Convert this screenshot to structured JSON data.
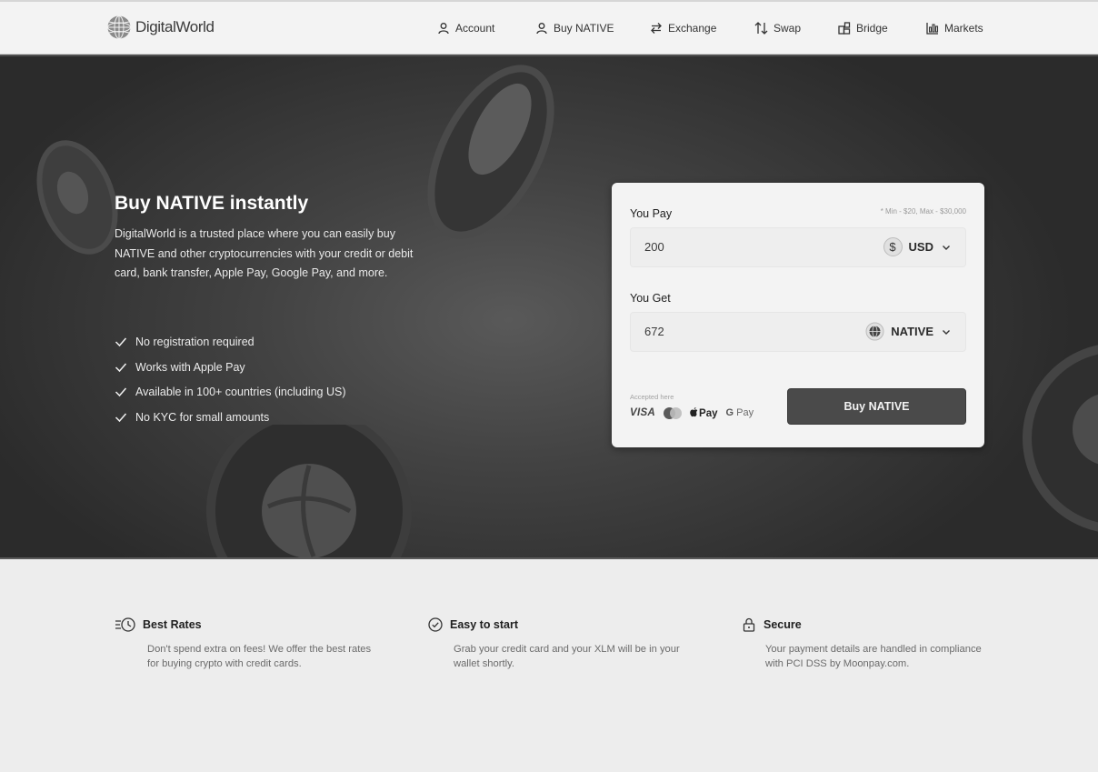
{
  "header": {
    "logo_text": "DigitalWorld",
    "nav": [
      {
        "label": "Account",
        "icon": "user-icon"
      },
      {
        "label": "Buy NATIVE",
        "icon": "user-icon"
      },
      {
        "label": "Exchange",
        "icon": "exchange-icon"
      },
      {
        "label": "Swap",
        "icon": "swap-icon"
      },
      {
        "label": "Bridge",
        "icon": "bridge-icon"
      },
      {
        "label": "Markets",
        "icon": "markets-icon"
      }
    ]
  },
  "hero": {
    "title": "Buy NATIVE instantly",
    "description": "DigitalWorld is a trusted place where you can easily buy NATIVE and other cryptocurrencies with your credit or debit card, bank transfer, Apple Pay, Google Pay, and more.",
    "features": [
      "No registration required",
      "Works with Apple Pay",
      "Available in 100+ countries (including US)",
      "No KYC for small amounts"
    ]
  },
  "widget": {
    "pay_label": "You Pay",
    "limits": "* Min - $20, Max - $30,000",
    "pay_amount": "200",
    "pay_currency_symbol": "$",
    "pay_currency": "USD",
    "get_label": "You Get",
    "get_amount": "672",
    "get_currency": "NATIVE",
    "accepted_label": "Accepted here",
    "payment_methods": {
      "visa": "VISA",
      "apple_pay": "Pay",
      "google_pay": "Pay",
      "google_g": "G"
    },
    "buy_button": "Buy NATIVE"
  },
  "info": [
    {
      "title": "Best Rates",
      "text": "Don't spend extra on fees! We offer the best rates for buying crypto with credit cards.",
      "icon": "clock-list-icon"
    },
    {
      "title": "Easy to start",
      "text": "Grab your credit card and your XLM will be in your wallet shortly.",
      "icon": "check-circle-icon"
    },
    {
      "title": "Secure",
      "text": "Your payment details are handled in compliance with PCI DSS by Moonpay.com.",
      "icon": "lock-icon"
    }
  ],
  "colors": {
    "hero_bg": "#3a3a3a",
    "card_bg": "#f3f3f3",
    "button_bg": "#4a4a4a",
    "page_bg": "#ededed"
  }
}
